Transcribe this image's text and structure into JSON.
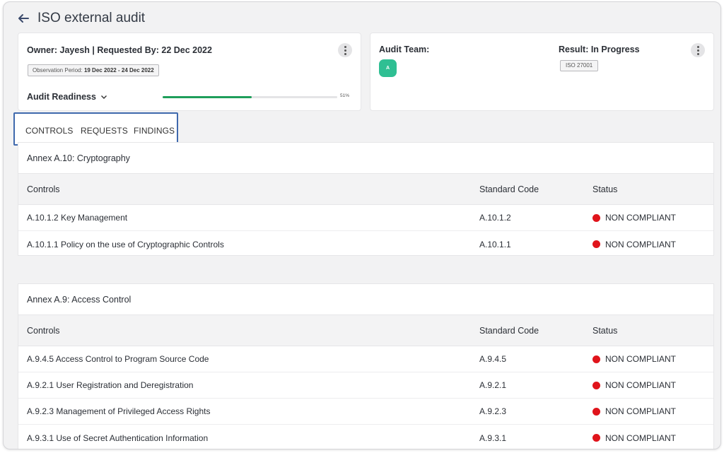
{
  "header": {
    "title": "ISO external audit"
  },
  "summary": {
    "owner_line": "Owner: Jayesh | Requested By: 22 Dec 2022",
    "observation_label": "Observation Period:",
    "observation_value": "19 Dec 2022 - 24 Dec 2022",
    "readiness_label": "Audit Readiness",
    "readiness_percent": 51,
    "readiness_percent_text": "51%"
  },
  "team": {
    "label": "Audit Team:",
    "avatar_initial": "A",
    "result_label": "Result: In Progress",
    "standard_badge": "ISO 27001"
  },
  "tabs": [
    {
      "label": "CONTROLS",
      "active": true
    },
    {
      "label": "REQUESTS",
      "active": false
    },
    {
      "label": "FINDINGS",
      "active": false
    }
  ],
  "columns": {
    "controls": "Controls",
    "code": "Standard Code",
    "status": "Status"
  },
  "sections": [
    {
      "title": "Annex A.10: Cryptography",
      "rows": [
        {
          "control": "A.10.1.2 Key Management",
          "code": "A.10.1.2",
          "status": "NON COMPLIANT"
        },
        {
          "control": "A.10.1.1 Policy on the use of Cryptographic Controls",
          "code": "A.10.1.1",
          "status": "NON COMPLIANT"
        }
      ]
    },
    {
      "title": "Annex A.9: Access Control",
      "rows": [
        {
          "control": "A.9.4.5 Access Control to Program Source Code",
          "code": "A.9.4.5",
          "status": "NON COMPLIANT"
        },
        {
          "control": "A.9.2.1 User Registration and Deregistration",
          "code": "A.9.2.1",
          "status": "NON COMPLIANT"
        },
        {
          "control": "A.9.2.3 Management of Privileged Access Rights",
          "code": "A.9.2.3",
          "status": "NON COMPLIANT"
        },
        {
          "control": "A.9.3.1 Use of Secret Authentication Information",
          "code": "A.9.3.1",
          "status": "NON COMPLIANT"
        }
      ]
    }
  ],
  "colors": {
    "progress_fill": "#1e9e5a",
    "avatar_bg": "#2fbf93",
    "status_non_compliant": "#e0141b",
    "tab_highlight": "#3f69ad"
  },
  "icons": {
    "back": "arrow-left-icon",
    "more": "more-vertical-icon",
    "chevron": "chevron-down-icon",
    "status": "status-dot-icon"
  }
}
